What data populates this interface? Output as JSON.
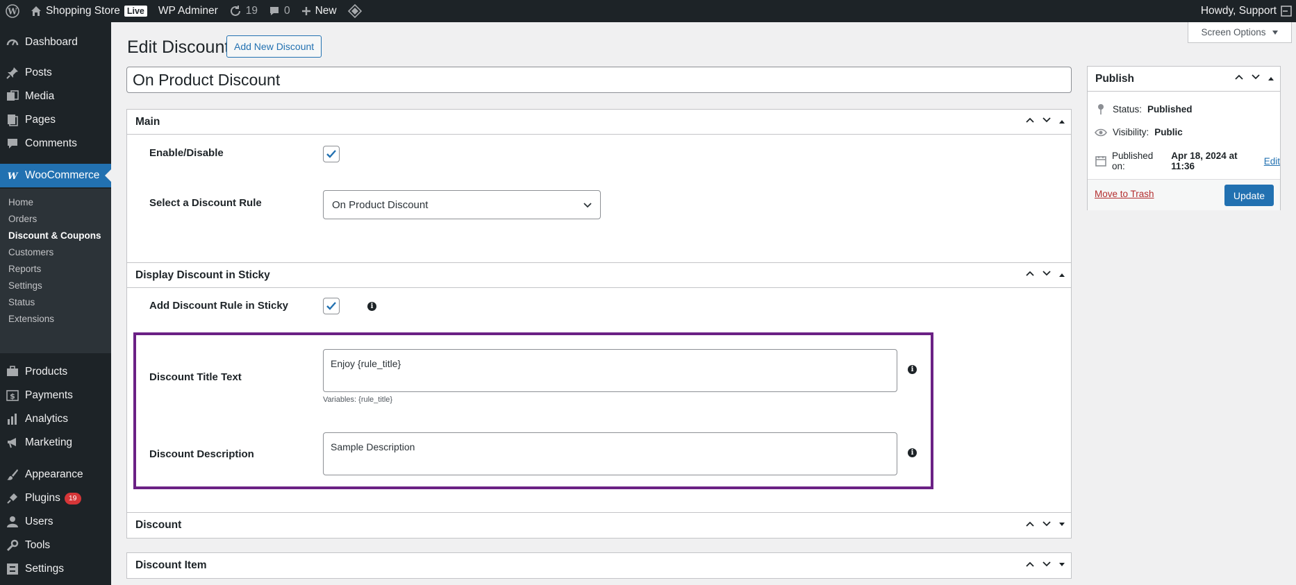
{
  "admin_bar": {
    "site_name": "Shopping Store",
    "live_badge": "Live",
    "plugin_label": "WP Adminer",
    "updates_count": "19",
    "comments_count": "0",
    "new_label": "New",
    "howdy": "Howdy, Support"
  },
  "sidebar": {
    "dashboard": "Dashboard",
    "posts": "Posts",
    "media": "Media",
    "pages": "Pages",
    "comments": "Comments",
    "woocommerce": "WooCommerce",
    "submenu": [
      "Home",
      "Orders",
      "Discount & Coupons",
      "Customers",
      "Reports",
      "Settings",
      "Status",
      "Extensions"
    ],
    "products": "Products",
    "payments": "Payments",
    "analytics": "Analytics",
    "marketing": "Marketing",
    "appearance": "Appearance",
    "plugins": "Plugins",
    "plugins_badge": "19",
    "users": "Users",
    "tools": "Tools",
    "settings": "Settings"
  },
  "page": {
    "title": "Edit Discount",
    "add_new": "Add New Discount",
    "screen_options": "Screen Options",
    "post_title": "On Product Discount"
  },
  "main_box": {
    "title": "Main",
    "enable_label": "Enable/Disable",
    "enable_checked": true,
    "rule_label": "Select a Discount Rule",
    "rule_value": "On Product Discount"
  },
  "sticky_box": {
    "title": "Display Discount in Sticky",
    "add_rule_label": "Add Discount Rule in Sticky",
    "add_rule_checked": true,
    "title_text_label": "Discount Title Text",
    "title_text_value": "Enjoy {rule_title}",
    "variables_hint": "Variables: {rule_title}",
    "description_label": "Discount Description",
    "description_value": "Sample Description"
  },
  "discount_box": {
    "title": "Discount"
  },
  "discount_item_box": {
    "title": "Discount Item"
  },
  "publish": {
    "title": "Publish",
    "status_label": "Status:",
    "status_value": "Published",
    "visibility_label": "Visibility:",
    "visibility_value": "Public",
    "published_label": "Published on:",
    "published_value": "Apr 18, 2024 at 11:36",
    "edit_link": "Edit",
    "trash": "Move to Trash",
    "update": "Update"
  },
  "colors": {
    "admin_dark": "#1d2327",
    "accent": "#2271b1",
    "highlight_border": "#6b2185",
    "badge": "#d63638"
  }
}
